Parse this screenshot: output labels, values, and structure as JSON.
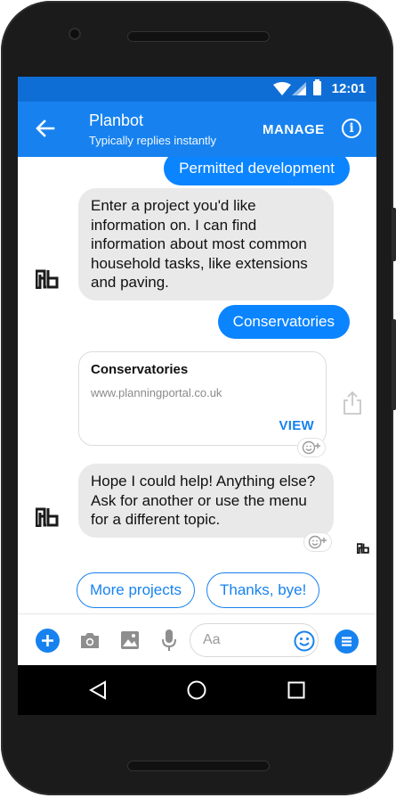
{
  "status_bar": {
    "time": "12:01"
  },
  "header": {
    "title": "Planbot",
    "subtitle": "Typically replies instantly",
    "manage_label": "MANAGE",
    "info_label": "i"
  },
  "messages": {
    "outgoing_1": "Permitted development",
    "incoming_1": "Enter a project you'd like information on. I can find information about most common household tasks, like extensions and paving.",
    "outgoing_2": "Conservatories",
    "card": {
      "title": "Conservatories",
      "url": "www.planningportal.co.uk",
      "action": "VIEW"
    },
    "incoming_2": "Hope I could help! Anything else? Ask for another or use the menu for a different topic."
  },
  "quick_replies": [
    "More projects",
    "Thanks, bye!"
  ],
  "composer": {
    "placeholder": "Aa"
  },
  "colors": {
    "status_bar": "#0f6ed6",
    "app_bar": "#1782ef",
    "outgoing_bubble": "#0b84ff",
    "incoming_bubble": "#e9e9e9",
    "accent": "#1782ef"
  },
  "icons": {
    "header": [
      "back-arrow-icon",
      "info-icon"
    ],
    "composer": [
      "plus-icon",
      "camera-icon",
      "image-icon",
      "microphone-icon",
      "emoji-icon",
      "menu-icon"
    ],
    "navbar": [
      "back-triangle-icon",
      "home-circle-icon",
      "recents-square-icon"
    ],
    "chat": [
      "planbot-avatar-icon",
      "share-icon",
      "add-reaction-icon"
    ]
  }
}
